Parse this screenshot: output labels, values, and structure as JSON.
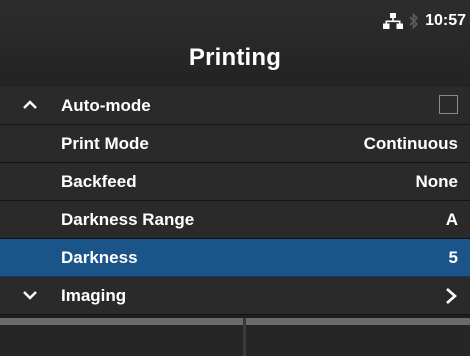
{
  "status": {
    "time": "10:57",
    "icons": [
      "network-icon",
      "bluetooth-icon"
    ]
  },
  "header": {
    "title": "Printing"
  },
  "menu": {
    "items": [
      {
        "label": "Auto-mode",
        "indicator": "chevron-up-icon",
        "control": "checkbox",
        "checked": false
      },
      {
        "label": "Print Mode",
        "value": "Continuous"
      },
      {
        "label": "Backfeed",
        "value": "None"
      },
      {
        "label": "Darkness Range",
        "value": "A"
      },
      {
        "label": "Darkness",
        "value": "5",
        "selected": true
      },
      {
        "label": "Imaging",
        "indicator": "chevron-down-icon",
        "control": "submenu-arrow"
      }
    ]
  },
  "softkeys": {
    "left_label": "",
    "right_label": ""
  },
  "colors": {
    "selected_row": "#1a5488",
    "row": "#2a2a2a",
    "text": "#ffffff"
  }
}
